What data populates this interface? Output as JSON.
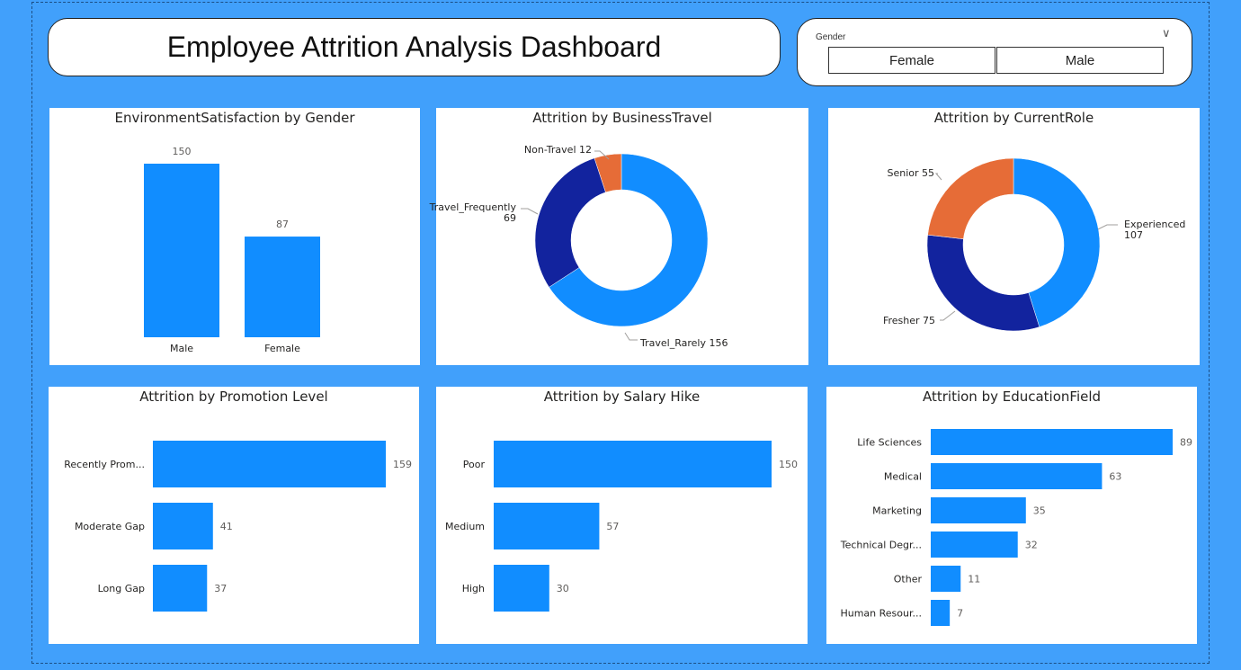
{
  "dashboard": {
    "title": "Employee Attrition Analysis Dashboard",
    "slicer": {
      "label": "Gender",
      "options": [
        "Female",
        "Male"
      ]
    }
  },
  "colors": {
    "background": "#41a0fb",
    "bar": "#118dff",
    "light_blue": "#118dff",
    "dark_navy": "#12239e",
    "orange": "#e66c37"
  },
  "chart_data": [
    {
      "type": "bar",
      "title": "EnvironmentSatisfaction by Gender",
      "categories": [
        "Male",
        "Female"
      ],
      "values": [
        150,
        87
      ],
      "xlabel": "",
      "ylabel": ""
    },
    {
      "type": "pie",
      "title": "Attrition by BusinessTravel",
      "donut": true,
      "slices": [
        {
          "label": "Travel_Rarely",
          "value": 156,
          "color": "#118dff"
        },
        {
          "label": "Travel_Frequently",
          "value": 69,
          "color": "#12239e"
        },
        {
          "label": "Non-Travel",
          "value": 12,
          "color": "#e66c37"
        }
      ]
    },
    {
      "type": "pie",
      "title": "Attrition by CurrentRole",
      "donut": true,
      "slices": [
        {
          "label": "Experienced",
          "value": 107,
          "color": "#118dff"
        },
        {
          "label": "Fresher",
          "value": 75,
          "color": "#12239e"
        },
        {
          "label": "Senior",
          "value": 55,
          "color": "#e66c37"
        }
      ]
    },
    {
      "type": "bar",
      "orientation": "horizontal",
      "title": "Attrition by Promotion Level",
      "categories": [
        "Recently Prom...",
        "Moderate Gap",
        "Long Gap"
      ],
      "values": [
        159,
        41,
        37
      ]
    },
    {
      "type": "bar",
      "orientation": "horizontal",
      "title": "Attrition by Salary Hike",
      "categories": [
        "Poor",
        "Medium",
        "High"
      ],
      "values": [
        150,
        57,
        30
      ]
    },
    {
      "type": "bar",
      "orientation": "horizontal",
      "title": "Attrition by EducationField",
      "categories": [
        "Life Sciences",
        "Medical",
        "Marketing",
        "Technical Degr...",
        "Other",
        "Human Resour..."
      ],
      "values": [
        89,
        63,
        35,
        32,
        11,
        7
      ]
    }
  ]
}
